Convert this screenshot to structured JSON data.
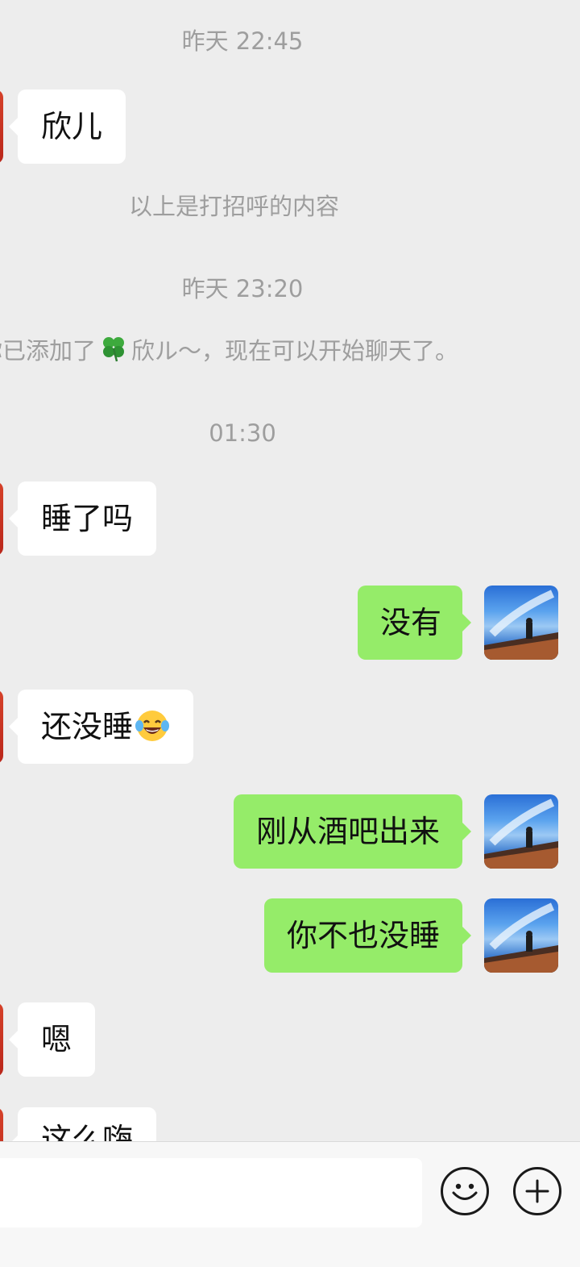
{
  "messages": {
    "ts1": "昨天 22:45",
    "peer_xiner": "欣儿",
    "greeting_note": "以上是打招呼的内容",
    "ts2": "昨天 23:20",
    "added_prefix": "你已添加了",
    "added_suffix": "欣ル～，现在可以开始聊天了。",
    "ts3": "01:30",
    "peer_sleep_q": "睡了吗",
    "self_no": "没有",
    "peer_not_yet": "还没睡",
    "self_bar": "刚从酒吧出来",
    "self_you_too": "你不也没睡",
    "peer_en": "嗯",
    "peer_partial": "这么嗨"
  },
  "emoji": {
    "clover": "four-leaf-clover-icon",
    "laugh": "face-with-tears-of-joy-icon"
  },
  "colors": {
    "background": "#EDEDED",
    "incoming_bubble": "#FFFFFF",
    "outgoing_bubble": "#95EC69",
    "meta_text": "#9E9E9E"
  },
  "input_bar": {
    "emoji_button_icon": "smiley-icon",
    "plus_button_icon": "plus-icon"
  }
}
